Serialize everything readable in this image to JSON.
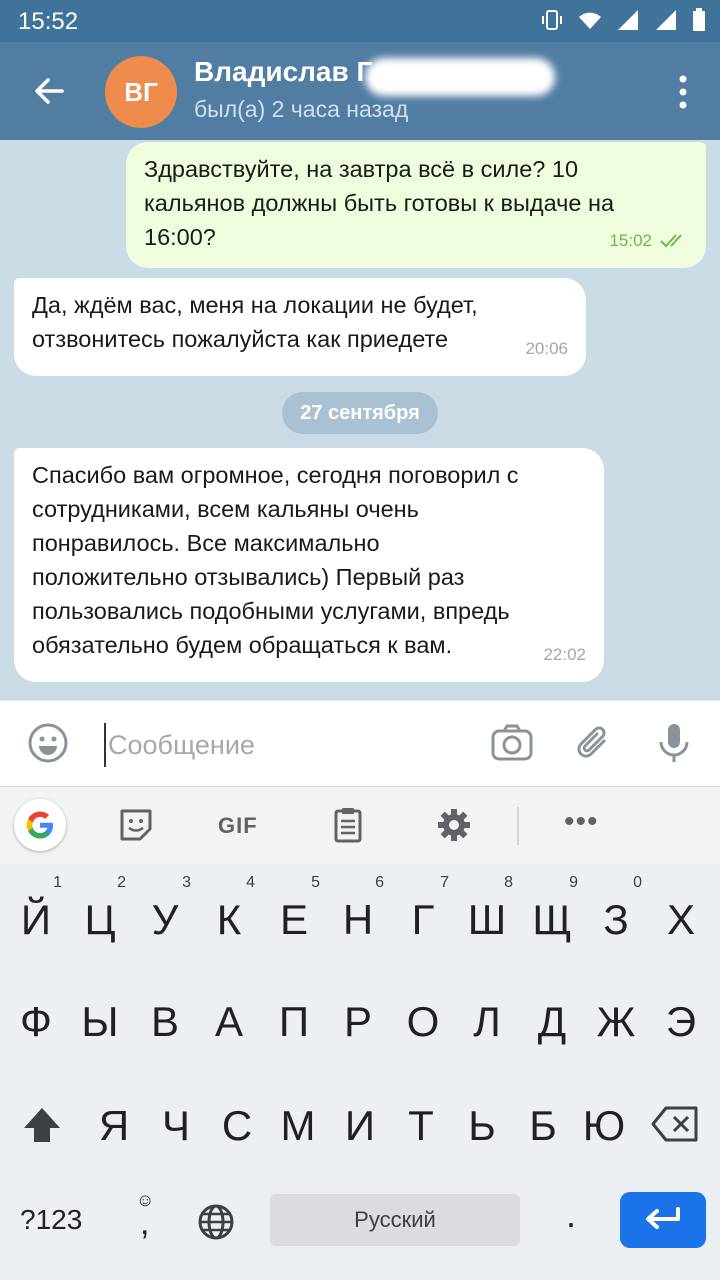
{
  "status_bar": {
    "time": "15:52",
    "icons": [
      "vibrate-icon",
      "wifi-icon",
      "signal-icon",
      "signal-icon-2",
      "battery-icon"
    ]
  },
  "header": {
    "back_icon": "arrow-left-icon",
    "avatar_initials": "ВГ",
    "avatar_color": "#ef8b4c",
    "contact_name": "Владислав Г",
    "status": "был(а) 2 часа назад",
    "menu_icon": "more-vertical-icon"
  },
  "messages": [
    {
      "direction": "outgoing",
      "text": "Здравствуйте, на завтра всё в силе? 10\nкальянов должны быть готовы к выдаче на\n16:00?",
      "time": "15:02",
      "read": true
    },
    {
      "direction": "incoming",
      "text": "Да, ждём вас, меня на локации не будет,\nотзвонитесь пожалуйста как приедете",
      "time": "20:06"
    },
    {
      "direction": "incoming",
      "text": "Спасибо вам огромное, сегодня поговорил с\nсотрудниками, всем кальяны очень\nпонравилось. Все максимально\nположительно отзывались) Первый раз\nпользовались подобными услугами, впредь\nобязательно будем обращаться к вам.",
      "time": "22:02"
    }
  ],
  "date_separator": "27 сентября",
  "input": {
    "placeholder": "Сообщение",
    "value": ""
  },
  "keyboard": {
    "toolbar": {
      "gif_label": "GIF",
      "more_label": "•••"
    },
    "row1": [
      {
        "key": "Й",
        "hint": "1"
      },
      {
        "key": "Ц",
        "hint": "2"
      },
      {
        "key": "У",
        "hint": "3"
      },
      {
        "key": "К",
        "hint": "4"
      },
      {
        "key": "Е",
        "hint": "5"
      },
      {
        "key": "Н",
        "hint": "6"
      },
      {
        "key": "Г",
        "hint": "7"
      },
      {
        "key": "Ш",
        "hint": "8"
      },
      {
        "key": "Щ",
        "hint": "9"
      },
      {
        "key": "З",
        "hint": "0"
      },
      {
        "key": "Х",
        "hint": ""
      }
    ],
    "row2": [
      "Ф",
      "Ы",
      "В",
      "А",
      "П",
      "Р",
      "О",
      "Л",
      "Д",
      "Ж",
      "Э"
    ],
    "row3": [
      "Я",
      "Ч",
      "С",
      "М",
      "И",
      "Т",
      "Ь",
      "Б",
      "Ю"
    ],
    "symbols_label": "?123",
    "comma_label": ",",
    "emoji_hint": "☺",
    "space_label": "Русский",
    "period_label": ".",
    "accent_color": "#1a73e8"
  }
}
